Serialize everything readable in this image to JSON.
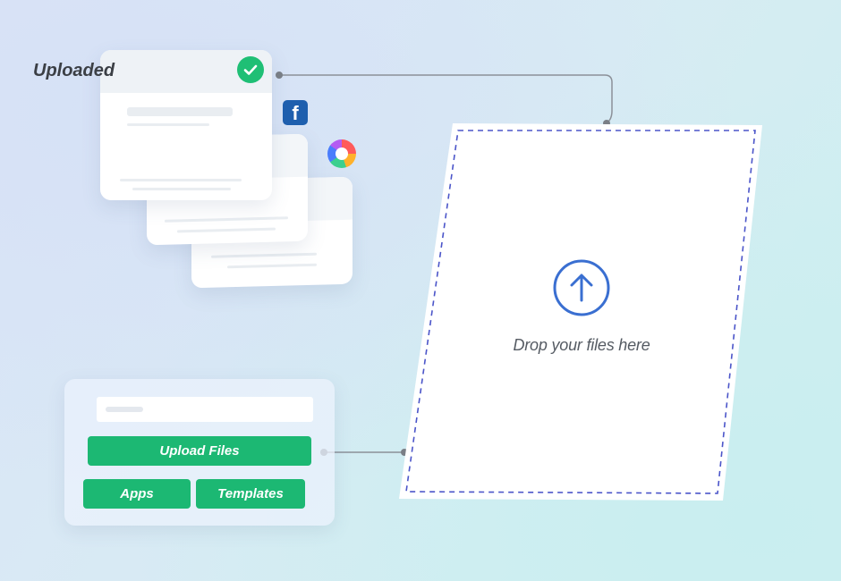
{
  "uploaded_card": {
    "label": "Uploaded",
    "status_icon": "check-icon"
  },
  "source_cards": [
    {
      "icon": "facebook-icon",
      "glyph": "f"
    },
    {
      "icon": "color-ring-icon"
    }
  ],
  "dropzone": {
    "text": "Drop your files here",
    "icon": "upload-arrow-icon",
    "border_color": "#4b55c9"
  },
  "upload_panel": {
    "upload_button": "Upload Files",
    "apps_button": "Apps",
    "templates_button": "Templates"
  },
  "colors": {
    "accent_green": "#1cb873",
    "check_green": "#1fbf75",
    "upload_blue": "#3a6fd1",
    "facebook_blue": "#1e5fae"
  }
}
